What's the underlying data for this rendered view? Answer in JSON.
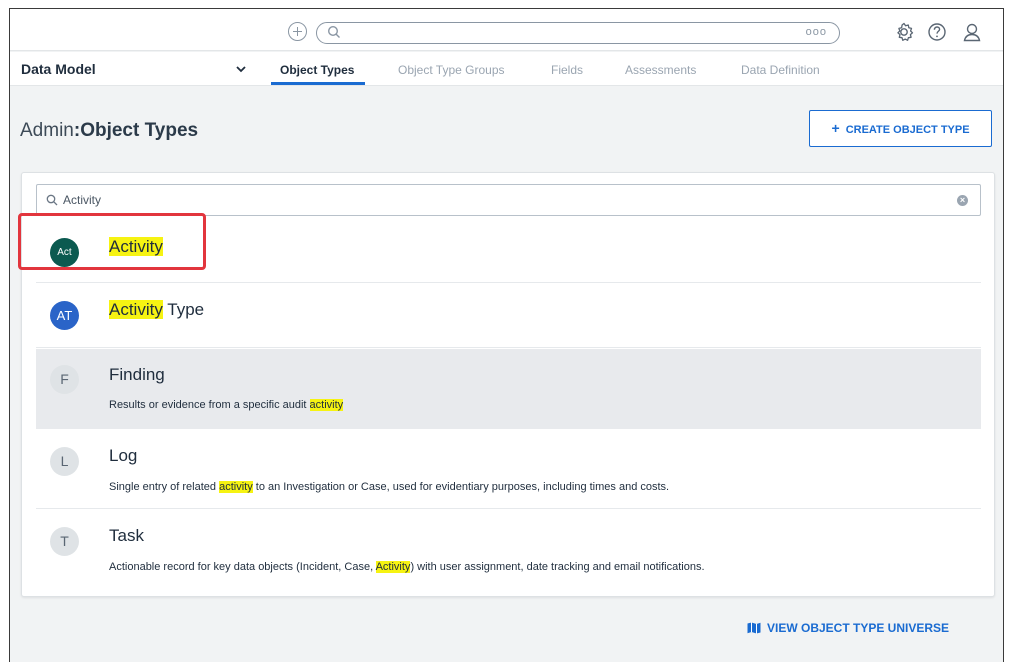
{
  "topbar": {
    "search_dots": "ooo"
  },
  "nav": {
    "app_selector_label": "Data Model",
    "tabs": [
      {
        "label": "Object Types",
        "active": true
      },
      {
        "label": "Object Type Groups",
        "active": false
      },
      {
        "label": "Fields",
        "active": false
      },
      {
        "label": "Assessments",
        "active": false
      },
      {
        "label": "Data Definition",
        "active": false
      }
    ]
  },
  "header": {
    "prefix": "Admin",
    "separator": ":",
    "title": "Object Types",
    "create_button_label": "CREATE OBJECT TYPE"
  },
  "search": {
    "value": "Activity",
    "highlight_color": "#f6f312"
  },
  "results": [
    {
      "avatar": "Act",
      "title_highlight": "Activity",
      "title_rest": "",
      "description": null,
      "avatar_color": "#0b5a50"
    },
    {
      "avatar": "AT",
      "title_highlight": "Activity",
      "title_rest": " Type",
      "description": null,
      "avatar_color": "#2a64c8"
    },
    {
      "avatar": "F",
      "title": "Finding",
      "desc_before": "Results or evidence from a specific audit ",
      "desc_highlight": "activity",
      "desc_after": ""
    },
    {
      "avatar": "L",
      "title": "Log",
      "desc_before": "Single entry of related ",
      "desc_highlight": "activity",
      "desc_after": " to an Investigation or Case, used for evidentiary purposes, including times and costs."
    },
    {
      "avatar": "T",
      "title": "Task",
      "desc_before": "Actionable record for key data objects (Incident, Case, ",
      "desc_highlight": "Activity",
      "desc_after": ") with user assignment, date tracking and email notifications."
    }
  ],
  "footer": {
    "universe_link_label": "VIEW OBJECT TYPE UNIVERSE"
  },
  "colors": {
    "accent": "#1a6bd1",
    "callout_border": "#e2353d"
  }
}
